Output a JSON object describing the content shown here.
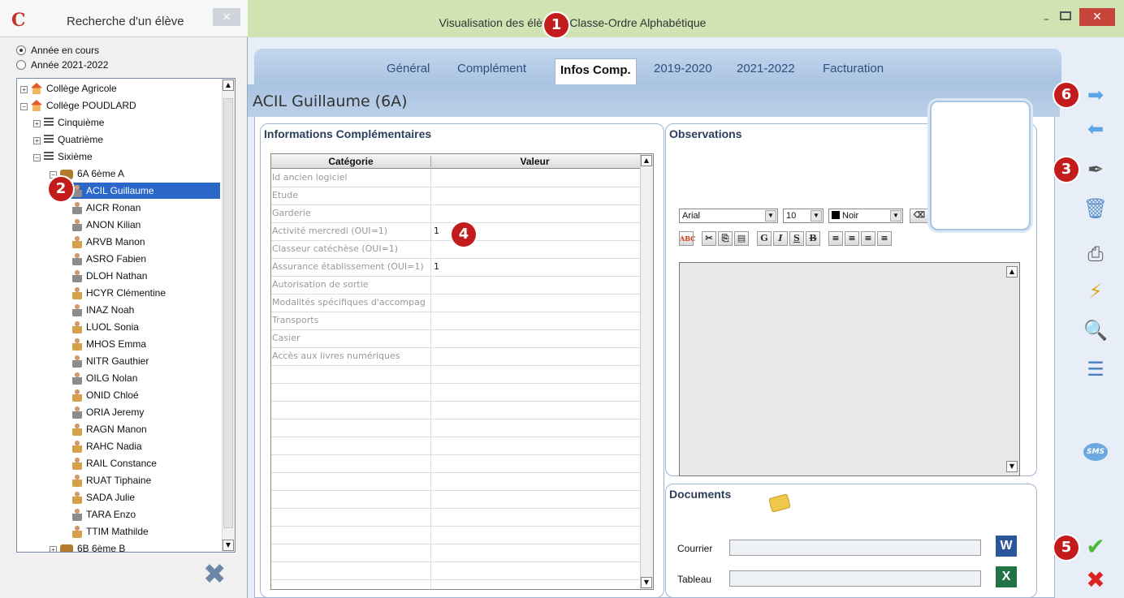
{
  "left": {
    "logo": "C",
    "title": "Recherche d'un élève",
    "close": "×",
    "radios": [
      {
        "label": "Année en cours",
        "checked": true
      },
      {
        "label": "Année 2021-2022",
        "checked": false
      }
    ],
    "tree": [
      {
        "label": "Collège Agricole",
        "exp": "+",
        "icon": "house"
      },
      {
        "label": "Collège POUDLARD",
        "exp": "−",
        "icon": "house"
      },
      {
        "label": "Cinquième",
        "exp": "+",
        "icon": "list"
      },
      {
        "label": "Quatrième",
        "exp": "+",
        "icon": "list"
      },
      {
        "label": "Sixième",
        "exp": "−",
        "icon": "list"
      },
      {
        "label": "6A 6ème A",
        "exp": "−",
        "icon": "group"
      },
      {
        "label": "ACIL Guillaume",
        "icon": "person"
      },
      {
        "label": "AICR Ronan",
        "icon": "person"
      },
      {
        "label": "ANON Kilian",
        "icon": "person"
      },
      {
        "label": "ARVB Manon",
        "icon": "person-f"
      },
      {
        "label": "ASRO Fabien",
        "icon": "person"
      },
      {
        "label": "DLOH Nathan",
        "icon": "person"
      },
      {
        "label": "HCYR Clémentine",
        "icon": "person-f"
      },
      {
        "label": "INAZ Noah",
        "icon": "person"
      },
      {
        "label": "LUOL Sonia",
        "icon": "person-f"
      },
      {
        "label": "MHOS Emma",
        "icon": "person-f"
      },
      {
        "label": "NITR Gauthier",
        "icon": "person"
      },
      {
        "label": "OILG Nolan",
        "icon": "person"
      },
      {
        "label": "ONID Chloé",
        "icon": "person-f"
      },
      {
        "label": "ORIA Jeremy",
        "icon": "person"
      },
      {
        "label": "RAGN Manon",
        "icon": "person-f"
      },
      {
        "label": "RAHC Nadia",
        "icon": "person-f"
      },
      {
        "label": "RAIL Constance",
        "icon": "person-f"
      },
      {
        "label": "RUAT Tiphaine",
        "icon": "person-f"
      },
      {
        "label": "SADA Julie",
        "icon": "person-f"
      },
      {
        "label": "TARA Enzo",
        "icon": "person"
      },
      {
        "label": "TTIM Mathilde",
        "icon": "person-f"
      },
      {
        "label": "6B 6ème B",
        "exp": "+",
        "icon": "group"
      }
    ],
    "selected_index": 6
  },
  "main": {
    "title": "Visualisation des élèves : Classe-Ordre Alphabétique",
    "tabs": [
      "Général",
      "Complément",
      "Infos Comp.",
      "2019-2020",
      "2021-2022",
      "Facturation"
    ],
    "active_tab": "Infos Comp.",
    "student": "ACIL Guillaume (6A)"
  },
  "info_panel": {
    "title": "Informations Complémentaires",
    "col_category": "Catégorie",
    "col_value": "Valeur",
    "rows": [
      {
        "cat": "Id ancien logiciel",
        "val": ""
      },
      {
        "cat": "Etude",
        "val": ""
      },
      {
        "cat": "Garderie",
        "val": ""
      },
      {
        "cat": "Activité mercredi (OUI=1)",
        "val": "1"
      },
      {
        "cat": "Classeur catéchèse (OUI=1)",
        "val": ""
      },
      {
        "cat": "Assurance établissement (OUI=1)",
        "val": "1"
      },
      {
        "cat": "Autorisation de sortie",
        "val": ""
      },
      {
        "cat": "Modalités spécifiques d'accompag",
        "val": ""
      },
      {
        "cat": "Transports",
        "val": ""
      },
      {
        "cat": "Casier",
        "val": ""
      },
      {
        "cat": "Accès aux livres numériques",
        "val": ""
      }
    ]
  },
  "observations": {
    "title": "Observations",
    "font": "Arial",
    "size": "10",
    "color": "Noir",
    "color_hex": "#000000",
    "format_buttons": [
      "ABC",
      "✂",
      "⎘",
      "📋",
      "G",
      "I",
      "S",
      "B"
    ]
  },
  "documents": {
    "title": "Documents",
    "courrier": "Courrier",
    "tableau": "Tableau",
    "word": "W",
    "excel": "X"
  },
  "badges": [
    "1",
    "2",
    "3",
    "4",
    "5",
    "6"
  ],
  "toolbar_icons": [
    "next-arrow-icon",
    "prev-arrow-icon",
    "edit-pen-icon",
    "trash-icon",
    "print-icon",
    "export-icon",
    "zoom-icon",
    "list-view-icon",
    "sms-icon",
    "validate-icon",
    "cancel-icon"
  ],
  "sms_label": "SMS"
}
